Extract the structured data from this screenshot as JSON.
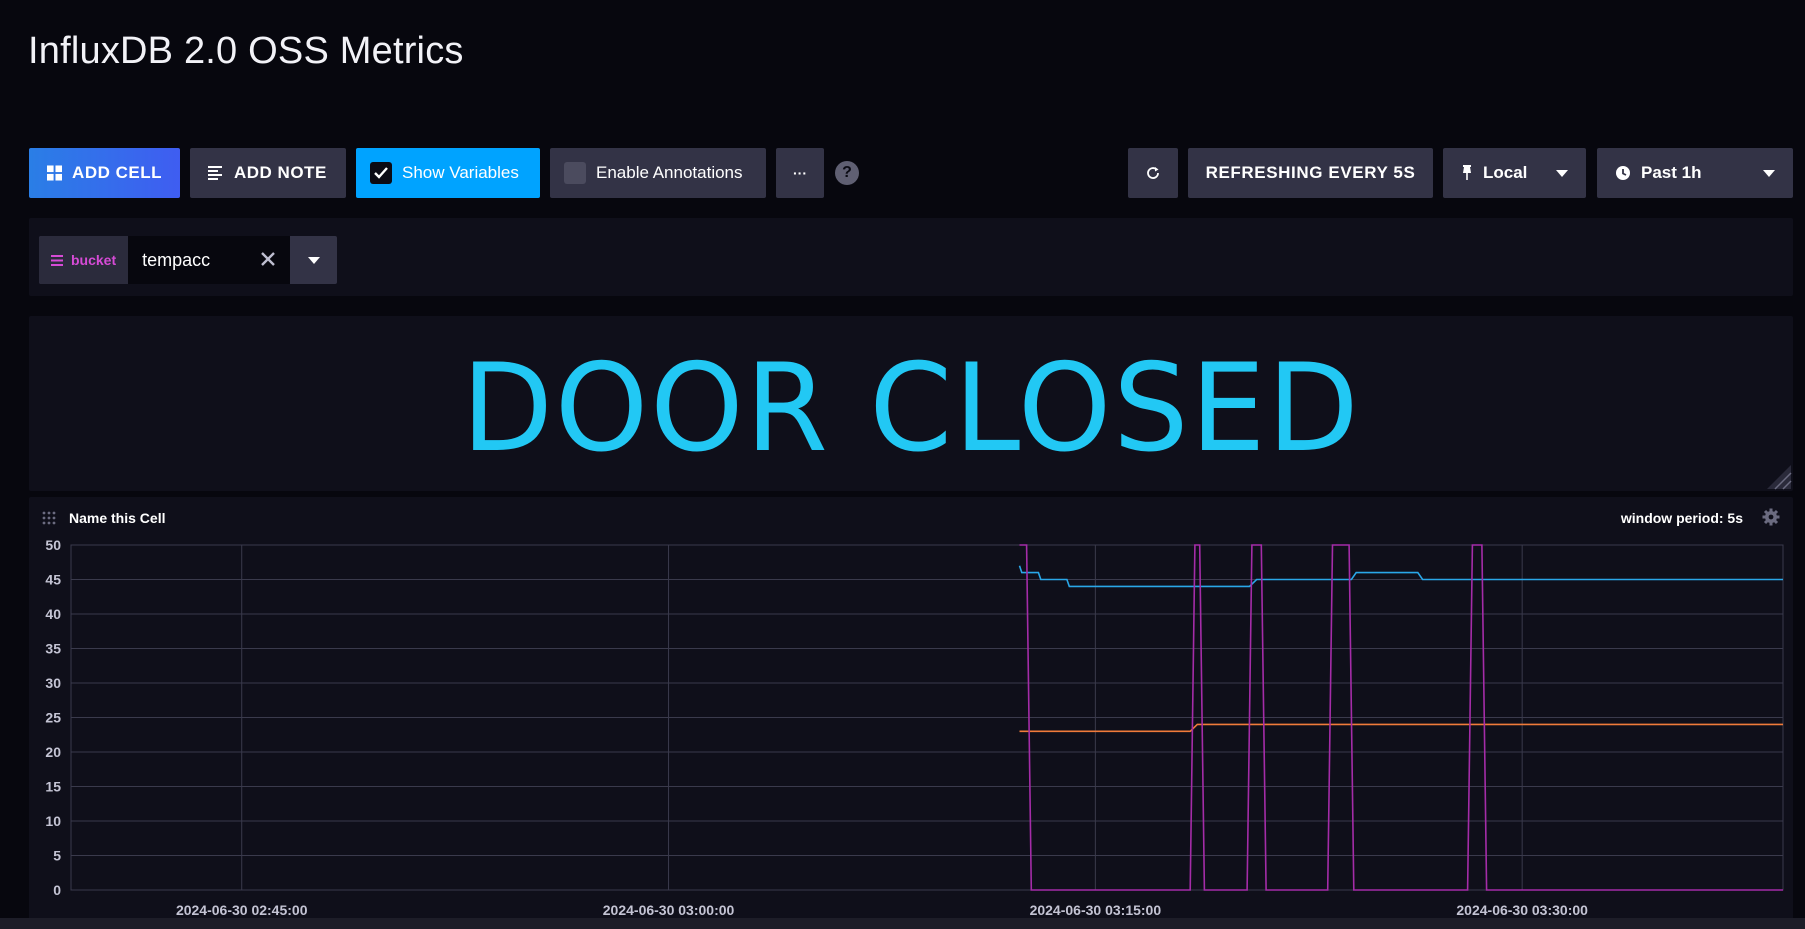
{
  "page": {
    "title": "InfluxDB 2.0 OSS Metrics"
  },
  "toolbar": {
    "add_cell": "ADD CELL",
    "add_note": "ADD NOTE",
    "show_variables": "Show Variables",
    "show_variables_checked": true,
    "enable_annotations": "Enable Annotations",
    "enable_annotations_checked": false,
    "more": "···",
    "help": "?",
    "refreshing": "REFRESHING EVERY 5S",
    "timezone": "Local",
    "time_range": "Past 1h"
  },
  "variables": [
    {
      "name": "bucket",
      "value": "tempacc"
    }
  ],
  "single_stat": {
    "text": "DOOR CLOSED",
    "color": "#22c8f4"
  },
  "graph_cell": {
    "name": "Name this Cell",
    "window_period": "window period: 5s"
  },
  "chart_data": {
    "type": "line",
    "x_axis_type": "time",
    "xlim": [
      "2024-06-30 02:39:00",
      "2024-06-30 03:39:10"
    ],
    "ylim": [
      0,
      50
    ],
    "y_ticks": [
      0,
      5,
      10,
      15,
      20,
      25,
      30,
      35,
      40,
      45,
      50
    ],
    "x_ticks": [
      "2024-06-30 02:45:00",
      "2024-06-30 03:00:00",
      "2024-06-30 03:15:00",
      "2024-06-30 03:30:00"
    ],
    "grid": true,
    "series": [
      {
        "color": "#2aa7e8",
        "points": [
          [
            "2024-06-30 03:12:20",
            47
          ],
          [
            "2024-06-30 03:12:25",
            46
          ],
          [
            "2024-06-30 03:13:00",
            46
          ],
          [
            "2024-06-30 03:13:05",
            45
          ],
          [
            "2024-06-30 03:14:00",
            45
          ],
          [
            "2024-06-30 03:14:05",
            44
          ],
          [
            "2024-06-30 03:20:25",
            44
          ],
          [
            "2024-06-30 03:20:40",
            45
          ],
          [
            "2024-06-30 03:24:00",
            45
          ],
          [
            "2024-06-30 03:24:10",
            46
          ],
          [
            "2024-06-30 03:26:20",
            46
          ],
          [
            "2024-06-30 03:26:30",
            45
          ],
          [
            "2024-06-30 03:39:10",
            45
          ]
        ]
      },
      {
        "color": "#f07b3a",
        "points": [
          [
            "2024-06-30 03:12:20",
            23
          ],
          [
            "2024-06-30 03:18:20",
            23
          ],
          [
            "2024-06-30 03:18:35",
            24
          ],
          [
            "2024-06-30 03:39:10",
            24
          ]
        ]
      },
      {
        "color": "#a42ca8",
        "points": [
          [
            "2024-06-30 03:12:20",
            50
          ],
          [
            "2024-06-30 03:12:35",
            50
          ],
          [
            "2024-06-30 03:12:45",
            0
          ],
          [
            "2024-06-30 03:18:20",
            0
          ],
          [
            "2024-06-30 03:18:30",
            50
          ],
          [
            "2024-06-30 03:18:40",
            50
          ],
          [
            "2024-06-30 03:18:50",
            0
          ],
          [
            "2024-06-30 03:20:20",
            0
          ],
          [
            "2024-06-30 03:20:30",
            50
          ],
          [
            "2024-06-30 03:20:50",
            50
          ],
          [
            "2024-06-30 03:21:00",
            0
          ],
          [
            "2024-06-30 03:23:10",
            0
          ],
          [
            "2024-06-30 03:23:20",
            50
          ],
          [
            "2024-06-30 03:23:55",
            50
          ],
          [
            "2024-06-30 03:24:05",
            0
          ],
          [
            "2024-06-30 03:28:05",
            0
          ],
          [
            "2024-06-30 03:28:15",
            50
          ],
          [
            "2024-06-30 03:28:35",
            50
          ],
          [
            "2024-06-30 03:28:45",
            0
          ],
          [
            "2024-06-30 03:39:10",
            0
          ]
        ]
      }
    ]
  }
}
